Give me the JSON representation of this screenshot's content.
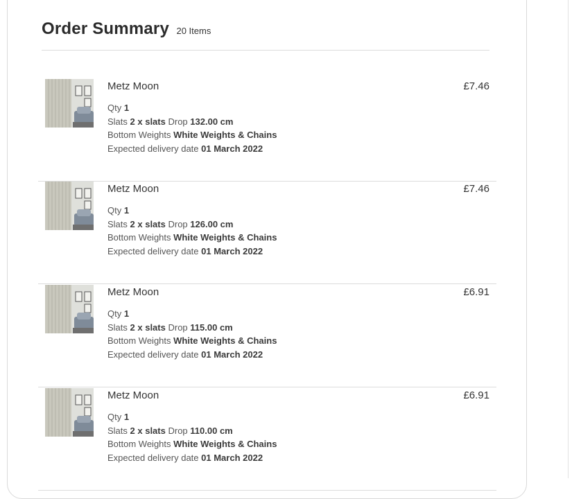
{
  "summary": {
    "title": "Order Summary",
    "count": "20 Items"
  },
  "labels": {
    "qty": "Qty",
    "slats": "Slats",
    "drop": "Drop",
    "bottom_weights": "Bottom Weights",
    "delivery": "Expected delivery date"
  },
  "items": [
    {
      "name": "Metz Moon",
      "price": "£7.46",
      "qty": "1",
      "slats": "2 x slats",
      "drop": "132.00 cm",
      "weights": "White Weights & Chains",
      "delivery": "01 March 2022"
    },
    {
      "name": "Metz Moon",
      "price": "£7.46",
      "qty": "1",
      "slats": "2 x slats",
      "drop": "126.00 cm",
      "weights": "White Weights & Chains",
      "delivery": "01 March 2022"
    },
    {
      "name": "Metz Moon",
      "price": "£6.91",
      "qty": "1",
      "slats": "2 x slats",
      "drop": "115.00 cm",
      "weights": "White Weights & Chains",
      "delivery": "01 March 2022"
    },
    {
      "name": "Metz Moon",
      "price": "£6.91",
      "qty": "1",
      "slats": "2 x slats",
      "drop": "110.00 cm",
      "weights": "White Weights & Chains",
      "delivery": "01 March 2022"
    }
  ]
}
